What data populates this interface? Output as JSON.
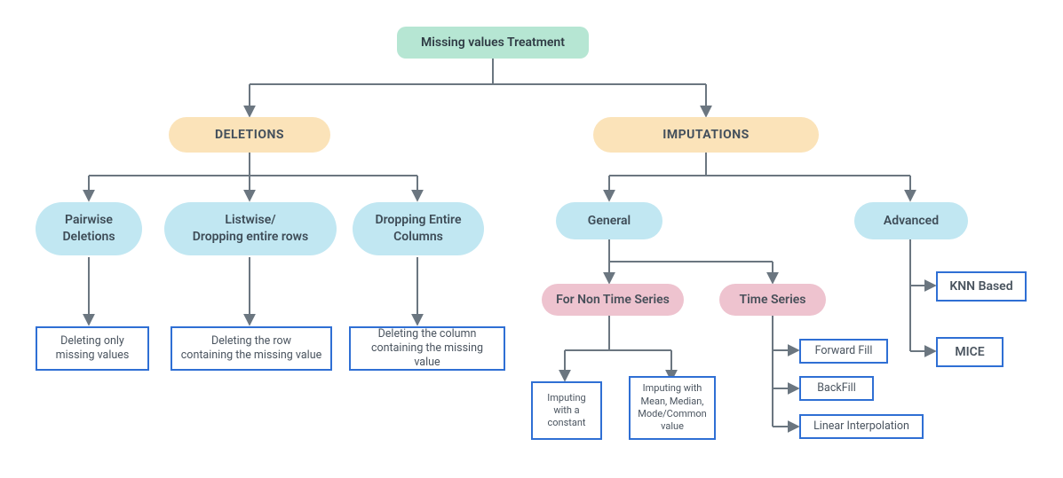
{
  "diagram": {
    "root": "Missing values Treatment",
    "branch_a": {
      "title": "DELETIONS",
      "children": [
        {
          "label": "Pairwise\nDeletions",
          "leaf": "Deleting only\nmissing values"
        },
        {
          "label": "Listwise/\nDropping entire rows",
          "leaf": "Deleting the row\ncontaining the missing value"
        },
        {
          "label": "Dropping Entire\nColumns",
          "leaf": "Deleting the column\ncontaining the missing value"
        }
      ]
    },
    "branch_b": {
      "title": "IMPUTATIONS",
      "general": {
        "label": "General",
        "non_ts": {
          "label": "For Non Time Series",
          "leaves": [
            "Imputing\nwith a\nconstant",
            "Imputing with\nMean, Median,\nMode/Common\nvalue"
          ]
        },
        "ts": {
          "label": "Time Series",
          "leaves": [
            "Forward Fill",
            "BackFill",
            "Linear Interpolation"
          ]
        }
      },
      "advanced": {
        "label": "Advanced",
        "leaves": [
          "KNN Based",
          "MICE"
        ]
      }
    }
  }
}
